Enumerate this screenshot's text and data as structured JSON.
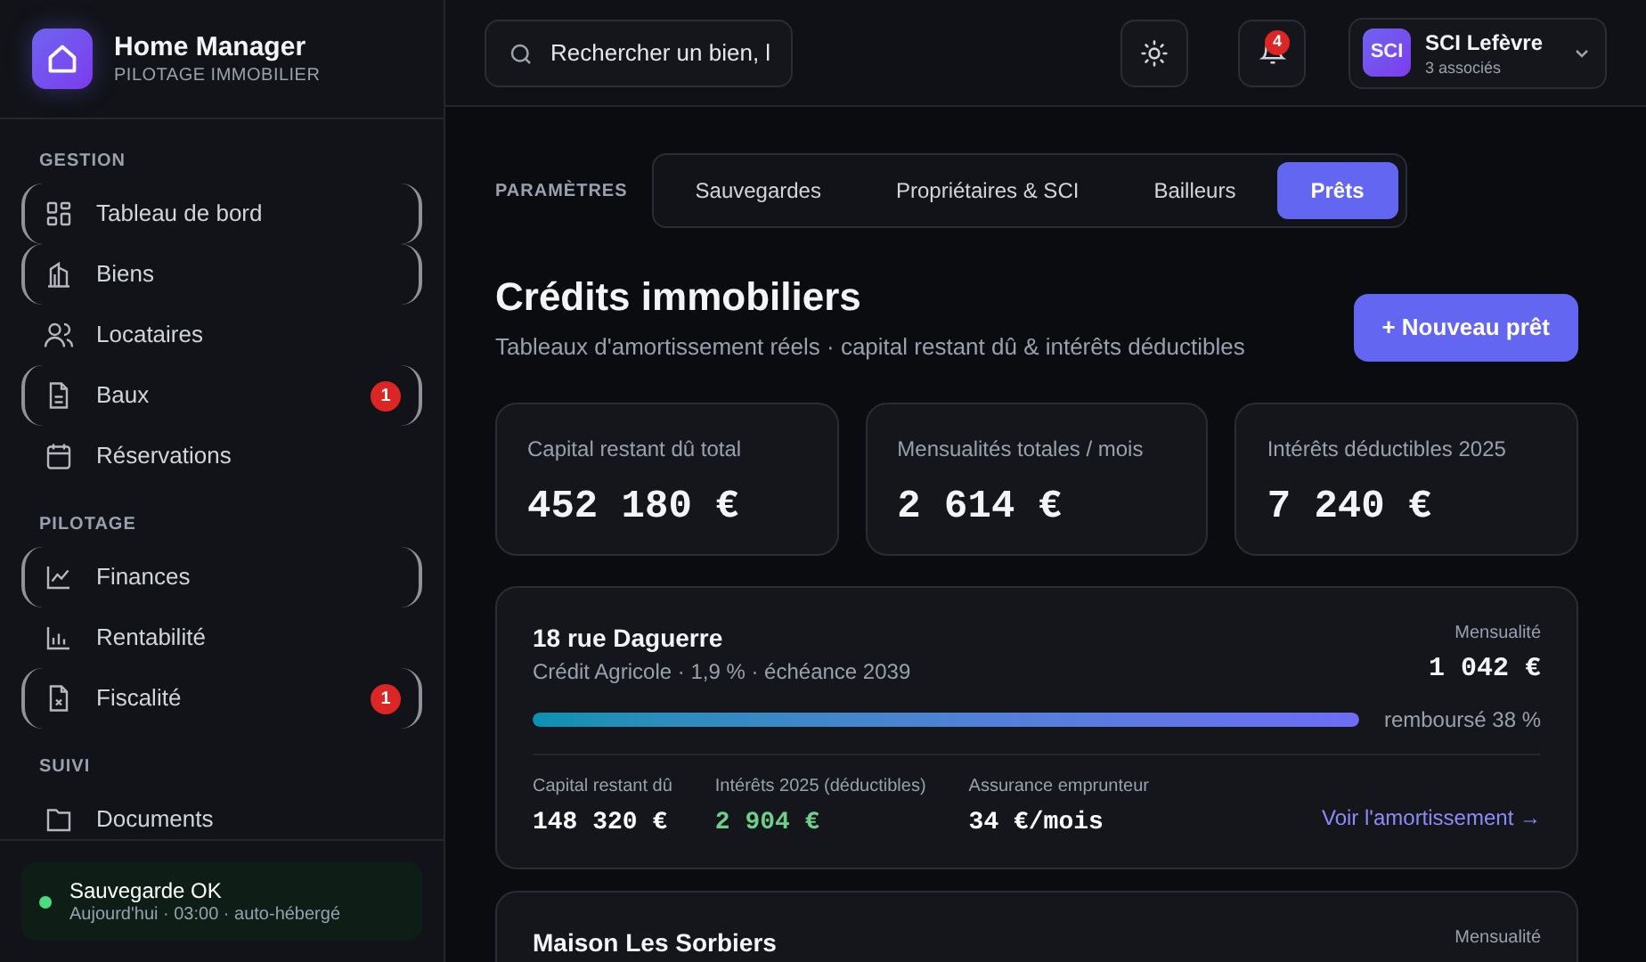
{
  "brand": {
    "title": "Home Manager",
    "subtitle": "PILOTAGE IMMOBILIER"
  },
  "sidebar": {
    "sections": [
      {
        "title": "GESTION",
        "items": [
          {
            "label": "Tableau de bord",
            "outlined": true
          },
          {
            "label": "Biens",
            "outlined": true
          },
          {
            "label": "Locataires",
            "outlined": false
          },
          {
            "label": "Baux",
            "outlined": true,
            "badge": "1"
          },
          {
            "label": "Réservations",
            "outlined": false
          }
        ]
      },
      {
        "title": "PILOTAGE",
        "items": [
          {
            "label": "Finances",
            "outlined": true
          },
          {
            "label": "Rentabilité",
            "outlined": false
          },
          {
            "label": "Fiscalité",
            "outlined": true,
            "badge": "1"
          }
        ]
      },
      {
        "title": "SUIVI",
        "items": [
          {
            "label": "Documents",
            "outlined": false
          }
        ]
      }
    ]
  },
  "backup": {
    "title": "Sauvegarde OK",
    "detail": "Aujourd'hui · 03:00 · auto-hébergé",
    "color": "#4ade80"
  },
  "search": {
    "placeholder": "Rechercher un bien, l"
  },
  "notifications": {
    "count": "4"
  },
  "account": {
    "initials": "SCI",
    "name": "SCI Lefèvre",
    "detail": "3 associés"
  },
  "settings_label": "PARAMÈTRES",
  "tabs": [
    {
      "label": "Sauvegardes",
      "selected": false
    },
    {
      "label": "Propriétaires & SCI",
      "selected": false
    },
    {
      "label": "Bailleurs",
      "selected": false
    },
    {
      "label": "Prêts",
      "selected": true
    }
  ],
  "page": {
    "title": "Crédits immobiliers",
    "subtitle": "Tableaux d'amortissement réels · capital restant dû & intérêts déductibles",
    "new_button": "+ Nouveau prêt"
  },
  "stats": [
    {
      "label": "Capital restant dû total",
      "value": "452 180 €"
    },
    {
      "label": "Mensualités totales / mois",
      "value": "2 614 €"
    },
    {
      "label": "Intérêts déductibles 2025",
      "value": "7 240 €"
    }
  ],
  "loans": [
    {
      "name": "18 rue Daguerre",
      "detail": "Crédit Agricole · 1,9 % · échéance 2039",
      "payment_label": "Mensualité",
      "payment": "1 042 €",
      "level": 1,
      "repaid": "remboursé 38 %",
      "fields": [
        {
          "label": "Capital restant dû",
          "value": "148 320 €",
          "kind": "plain"
        },
        {
          "label": "Intérêts 2025 (déductibles)",
          "value": "2 904 €",
          "kind": "positive"
        },
        {
          "label": "Assurance emprunteur",
          "value": "34 €/mois",
          "kind": "plain"
        }
      ],
      "link": "Voir l'amortissement →"
    },
    {
      "name": "Maison Les Sorbiers",
      "payment_label": "Mensualité"
    }
  ]
}
